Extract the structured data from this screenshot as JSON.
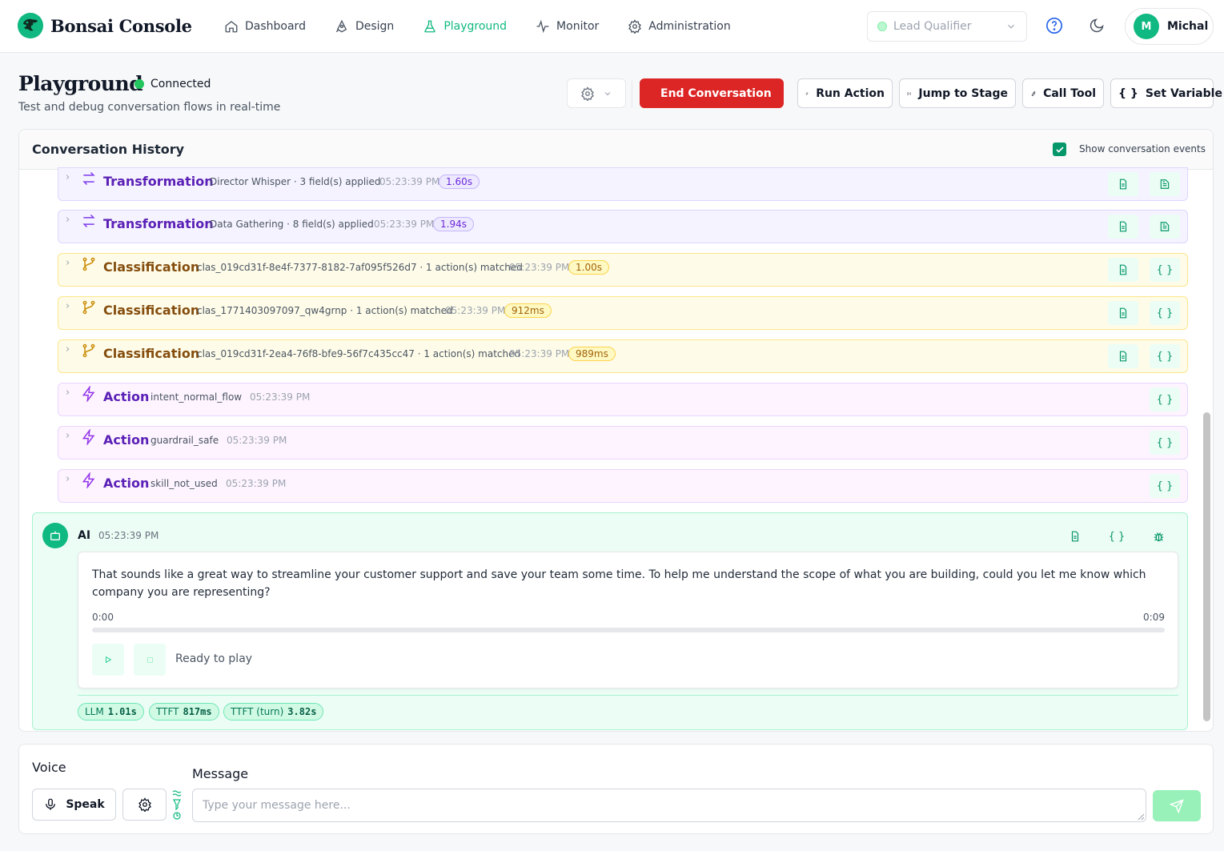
{
  "app": {
    "title": "Bonsai Console"
  },
  "nav": {
    "items": [
      {
        "label": "Dashboard",
        "icon": "home-icon"
      },
      {
        "label": "Design",
        "icon": "pen-tool-icon"
      },
      {
        "label": "Playground",
        "icon": "flask-icon",
        "active": true
      },
      {
        "label": "Monitor",
        "icon": "activity-icon"
      },
      {
        "label": "Administration",
        "icon": "gear-icon"
      }
    ],
    "agent_select": {
      "value": "Lead Qualifier"
    },
    "user": {
      "initial": "M",
      "name": "Michal"
    }
  },
  "header": {
    "title": "Playground",
    "status": "Connected",
    "subtitle": "Test and debug conversation flows in real-time",
    "buttons": {
      "end": "End Conversation",
      "run_action": "Run Action",
      "jump_stage": "Jump to Stage",
      "call_tool": "Call Tool",
      "set_variable": "Set Variable"
    }
  },
  "history": {
    "title": "Conversation History",
    "show_events_label": "Show conversation events",
    "show_events_checked": true,
    "events": [
      {
        "type": "Transformation",
        "detail": "Director Whisper · 3 field(s) applied",
        "time": "05:23:39 PM",
        "duration": "1.60s"
      },
      {
        "type": "Transformation",
        "detail": "Data Gathering · 8 field(s) applied",
        "time": "05:23:39 PM",
        "duration": "1.94s"
      },
      {
        "type": "Classification",
        "detail": "clas_019cd31f-8e4f-7377-8182-7af095f526d7 · 1 action(s) matched",
        "time": "05:23:39 PM",
        "duration": "1.00s"
      },
      {
        "type": "Classification",
        "detail": "clas_1771403097097_qw4grnp · 1 action(s) matched",
        "time": "05:23:39 PM",
        "duration": "912ms"
      },
      {
        "type": "Classification",
        "detail": "clas_019cd31f-2ea4-76f8-bfe9-56f7c435cc47 · 1 action(s) matched",
        "time": "05:23:39 PM",
        "duration": "989ms"
      },
      {
        "type": "Action",
        "detail": "intent_normal_flow",
        "time": "05:23:39 PM"
      },
      {
        "type": "Action",
        "detail": "guardrail_safe",
        "time": "05:23:39 PM"
      },
      {
        "type": "Action",
        "detail": "skill_not_used",
        "time": "05:23:39 PM"
      }
    ],
    "ai_message": {
      "sender": "AI",
      "time": "05:23:39 PM",
      "text": "That sounds like a great way to streamline your customer support and save your team some time. To help me understand the scope of what you are building, could you let me know which company you are representing?",
      "audio": {
        "current": "0:00",
        "duration": "0:09",
        "progress": 0,
        "status": "Ready to play"
      },
      "metrics": [
        {
          "label": "LLM",
          "value": "1.01s"
        },
        {
          "label": "TTFT",
          "value": "817ms"
        },
        {
          "label": "TTFT (turn)",
          "value": "3.82s"
        }
      ]
    }
  },
  "composer": {
    "voice_label": "Voice",
    "speak_label": "Speak",
    "message_label": "Message",
    "placeholder": "Type your message here..."
  },
  "colors": {
    "accent": "#10b981",
    "danger": "#dc2626",
    "transformation": "#7c3aed",
    "classification": "#ca8a04",
    "action": "#9333ea"
  }
}
